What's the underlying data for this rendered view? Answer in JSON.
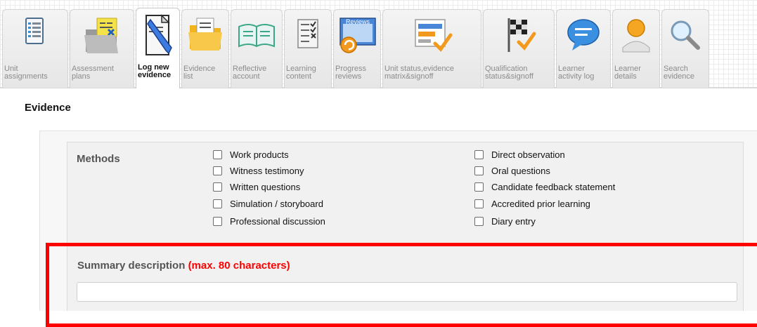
{
  "toolbar": {
    "tabs": [
      {
        "label": "Unit\nassignments",
        "icon": "unit-assignments-icon",
        "active": false
      },
      {
        "label": "Assessment\nplans",
        "icon": "assessment-plans-icon",
        "active": false
      },
      {
        "label": "Log new\nevidence",
        "icon": "log-new-evidence-icon",
        "active": true
      },
      {
        "label": "Evidence\nlist",
        "icon": "evidence-list-icon",
        "active": false
      },
      {
        "label": "Reflective\naccount",
        "icon": "reflective-account-icon",
        "active": false
      },
      {
        "label": "Learning\ncontent",
        "icon": "learning-content-icon",
        "active": false
      },
      {
        "label": "Progress\nreviews",
        "icon": "progress-reviews-icon",
        "icon_text": "Reviews",
        "active": false
      },
      {
        "label": "Unit status,evidence\nmatrix&signoff",
        "icon": "unit-status-icon",
        "active": false
      },
      {
        "label": "Qualification\nstatus&signoff",
        "icon": "qualification-status-icon",
        "active": false
      },
      {
        "label": "Learner\nactivity log",
        "icon": "learner-activity-log-icon",
        "active": false
      },
      {
        "label": "Learner\ndetails",
        "icon": "learner-details-icon",
        "active": false
      },
      {
        "label": "Search\nevidence",
        "icon": "search-evidence-icon",
        "active": false
      }
    ]
  },
  "page": {
    "title": "Evidence"
  },
  "methods": {
    "label": "Methods",
    "left": [
      {
        "label": "Work products",
        "checked": false
      },
      {
        "label": "Witness testimony",
        "checked": false
      },
      {
        "label": "Written questions",
        "checked": false
      },
      {
        "label": "Simulation / storyboard",
        "checked": false
      },
      {
        "label": "Professional discussion",
        "checked": false
      }
    ],
    "right": [
      {
        "label": "Direct observation",
        "checked": false
      },
      {
        "label": "Oral questions",
        "checked": false
      },
      {
        "label": "Candidate feedback statement",
        "checked": false
      },
      {
        "label": "Accredited prior learning",
        "checked": false
      },
      {
        "label": "Diary entry",
        "checked": false
      }
    ]
  },
  "summary": {
    "label": "Summary description",
    "hint": "(max. 80 characters)",
    "value": ""
  },
  "colors": {
    "highlight": "#ff0000",
    "hint": "#ff0000",
    "label": "#555555"
  }
}
